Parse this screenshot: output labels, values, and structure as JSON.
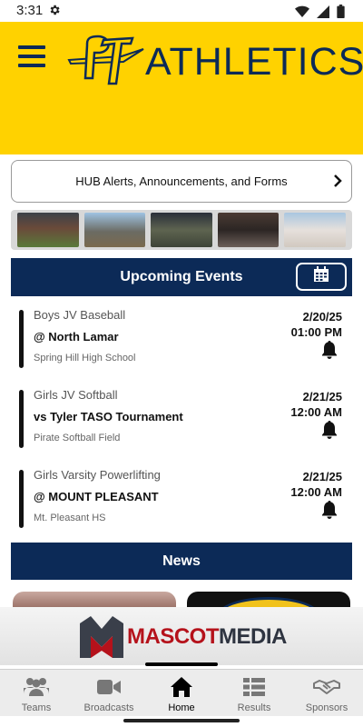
{
  "status_bar": {
    "time": "3:31",
    "icons": [
      "settings-gear-icon",
      "wifi-icon",
      "cellular-signal-icon",
      "battery-icon"
    ]
  },
  "header": {
    "brand_title": "ATHLETICS",
    "logo": "PT sword logo",
    "background_color": "#ffd200",
    "accent_color": "#0c2a57"
  },
  "hub": {
    "label": "HUB Alerts, Announcements, and Forms",
    "icon": "chevron-right-icon"
  },
  "photo_strip": {
    "photos": [
      "team-photo-1",
      "team-photo-2",
      "team-photo-3",
      "team-photo-4",
      "team-photo-5"
    ]
  },
  "upcoming_events": {
    "title": "Upcoming Events",
    "calendar_icon": "calendar-icon",
    "events": [
      {
        "sport": "Boys JV Baseball",
        "opponent": "@ North Lamar",
        "location": "Spring Hill High School",
        "date": "2/20/25",
        "time": "01:00 PM"
      },
      {
        "sport": "Girls JV Softball",
        "opponent": "vs Tyler TASO Tournament",
        "location": "Pirate Softball Field",
        "date": "2/21/25",
        "time": "12:00 AM"
      },
      {
        "sport": "Girls Varsity Powerlifting",
        "opponent": "@ MOUNT PLEASANT",
        "location": "Mt. Pleasant HS",
        "date": "2/21/25",
        "time": "12:00 AM"
      }
    ]
  },
  "news": {
    "title": "News"
  },
  "sponsor": {
    "name_part_1": "MASCOT",
    "name_part_2": "MEDIA",
    "logo_letter": "M"
  },
  "bottom_nav": {
    "items": [
      {
        "label": "Teams",
        "icon": "teams-icon",
        "active": false
      },
      {
        "label": "Broadcasts",
        "icon": "video-camera-icon",
        "active": false
      },
      {
        "label": "Home",
        "icon": "home-icon",
        "active": true
      },
      {
        "label": "Results",
        "icon": "results-list-icon",
        "active": false
      },
      {
        "label": "Sponsors",
        "icon": "handshake-icon",
        "active": false
      }
    ]
  }
}
